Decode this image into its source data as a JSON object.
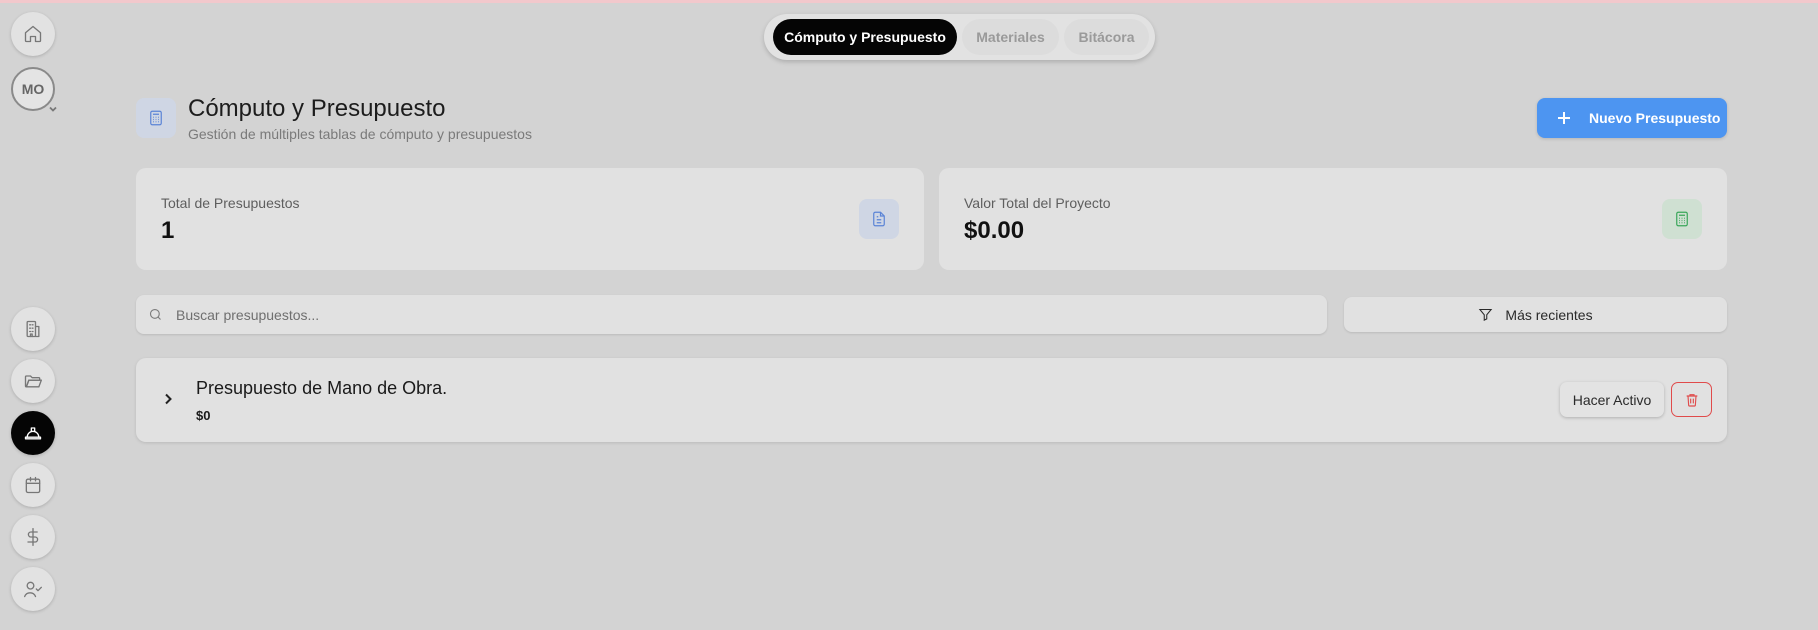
{
  "sidebar": {
    "avatar_initials": "MO",
    "items": [
      {
        "name": "home-icon"
      },
      {
        "name": "building-icon"
      },
      {
        "name": "folder-icon"
      },
      {
        "name": "hard-hat-icon",
        "active": true
      },
      {
        "name": "calendar-icon"
      },
      {
        "name": "dollar-icon"
      },
      {
        "name": "user-check-icon"
      }
    ]
  },
  "tabs": [
    {
      "label": "Cómputo y Presupuesto",
      "active": true
    },
    {
      "label": "Materiales",
      "active": false
    },
    {
      "label": "Bitácora",
      "active": false
    }
  ],
  "header": {
    "icon": "calculator-icon",
    "title": "Cómputo y Presupuesto",
    "subtitle": "Gestión de múltiples tablas de cómputo y presupuestos",
    "new_button_label": "Nuevo Presupuesto"
  },
  "stats": [
    {
      "label": "Total de Presupuestos",
      "value": "1",
      "icon": "file-text-icon",
      "icon_color": "#5b84d6",
      "icon_bg": "#cfd6e4"
    },
    {
      "label": "Valor Total del Proyecto",
      "value": "$0.00",
      "icon": "calculator-icon",
      "icon_color": "#3aa65a",
      "icon_bg": "#cfe0d2"
    }
  ],
  "search": {
    "placeholder": "Buscar presupuestos...",
    "value": ""
  },
  "sort": {
    "label": "Más recientes",
    "icon": "filter-icon"
  },
  "budgets": [
    {
      "name": "Presupuesto de Mano de Obra.",
      "amount": "$0",
      "activate_label": "Hacer Activo"
    }
  ],
  "colors": {
    "background": "#d3d3d3",
    "card": "#e1e1e1",
    "primary": "#4d95f1",
    "danger": "#e04b4b",
    "active_dark": "#050505"
  }
}
